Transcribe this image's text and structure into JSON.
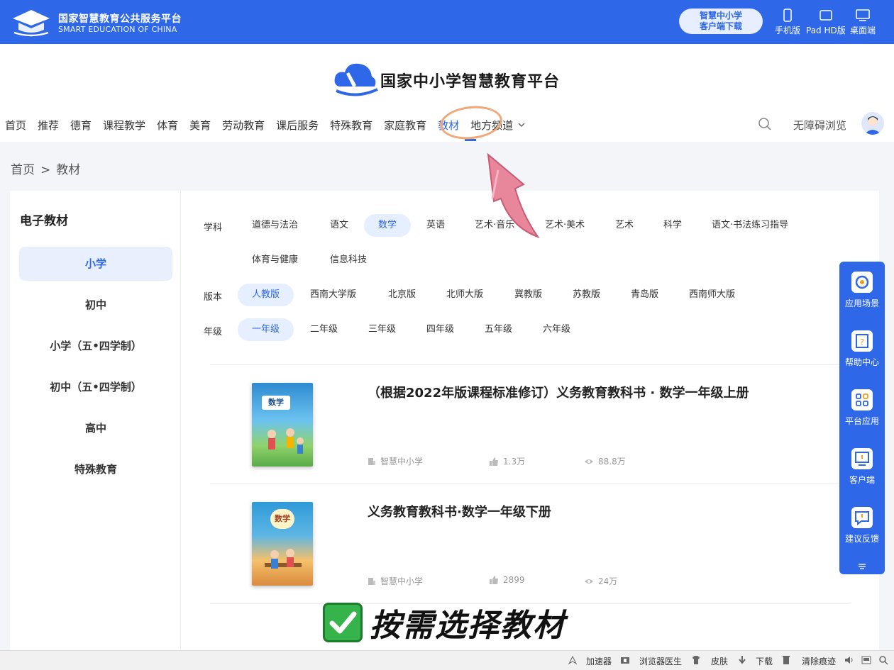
{
  "topbar": {
    "brand_cn": "国家智慧教育公共服务平台",
    "brand_en": "SMART EDUCATION OF CHINA",
    "download_line1": "智慧中小学",
    "download_line2": "客户端下载",
    "devices": [
      "手机版",
      "Pad HD版",
      "桌面端"
    ]
  },
  "header": {
    "platform_name": "国家中小学智慧教育平台",
    "nav": [
      "首页",
      "推荐",
      "德育",
      "课程教学",
      "体育",
      "美育",
      "劳动教育",
      "课后服务",
      "特殊教育",
      "家庭教育",
      "教材",
      "地方频道"
    ],
    "nav_active": "教材",
    "accessible": "无障碍浏览"
  },
  "breadcrumb": {
    "home": "首页",
    "sep": ">",
    "current": "教材"
  },
  "sidebar": {
    "title": "电子教材",
    "items": [
      "小学",
      "初中",
      "小学（五•四学制）",
      "初中（五•四学制）",
      "高中",
      "特殊教育"
    ]
  },
  "filters": {
    "subject_label": "学科",
    "subjects_row1": [
      "道德与法治",
      "语文",
      "数学",
      "英语",
      "艺术·音乐",
      "艺术·美术",
      "艺术",
      "科学",
      "语文·书法练习指导"
    ],
    "subjects_row2": [
      "体育与健康",
      "信息科技"
    ],
    "version_label": "版本",
    "versions": [
      "人教版",
      "西南大学版",
      "北京版",
      "北师大版",
      "冀教版",
      "苏教版",
      "青岛版",
      "西南师大版"
    ],
    "grade_label": "年级",
    "grades": [
      "一年级",
      "二年级",
      "三年级",
      "四年级",
      "五年级",
      "六年级"
    ]
  },
  "books": [
    {
      "title": "（根据2022年版课程标准修订）义务教育教科书 · 数学一年级上册",
      "source": "智慧中小学",
      "likes": "1.3万",
      "views": "88.8万",
      "cover_word": "数学"
    },
    {
      "title": "义务教育教科书·数学一年级下册",
      "source": "智慧中小学",
      "likes": "2899",
      "views": "24万",
      "cover_word": "数学"
    }
  ],
  "float_panel": [
    "应用场景",
    "帮助中心",
    "平台应用",
    "客户端",
    "建议反馈"
  ],
  "banner": "按需选择教材",
  "statusbar": [
    "加速器",
    "浏览器医生",
    "皮肤",
    "下载",
    "清除痕迹"
  ],
  "colors": {
    "brand": "#2e67e8",
    "chip_bg": "#e6efff",
    "highlight": "#f0a878",
    "arrow": "#e07a92"
  }
}
